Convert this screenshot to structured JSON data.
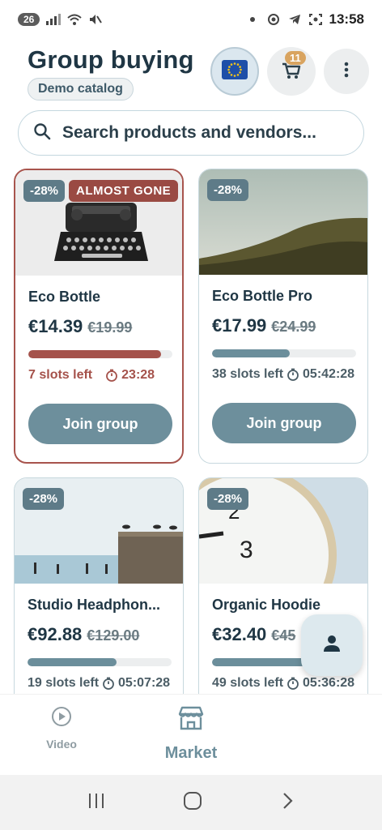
{
  "status_bar": {
    "notification_count": "26",
    "time": "13:58",
    "icons": [
      "sim-signal-icon",
      "wifi-icon",
      "mute-icon",
      "dot-icon",
      "chrome-icon",
      "telegram-icon",
      "screenshot-icon"
    ]
  },
  "header": {
    "title": "Group buying",
    "catalog_pill": "Demo catalog",
    "flag_icon": "eu-flag-icon",
    "cart_count": "11",
    "menu_icon": "more-vertical-icon"
  },
  "search": {
    "placeholder": "Search products and vendors..."
  },
  "products": [
    {
      "name": "Eco Bottle",
      "price": "€14.39",
      "old_price": "€19.99",
      "discount": "-28%",
      "badge": "ALMOST GONE",
      "slots": "7 slots left",
      "timer": "23:28",
      "progress": 0.92,
      "button": "Join group",
      "image": "typewriter-photo"
    },
    {
      "name": "Eco Bottle Pro",
      "price": "€17.99",
      "old_price": "€24.99",
      "discount": "-28%",
      "slots": "38 slots left",
      "timer": "05:42:28",
      "progress": 0.54,
      "button": "Join group",
      "image": "hill-landscape-photo"
    },
    {
      "name": "Studio Headphon...",
      "price": "€92.88",
      "old_price": "€129.00",
      "discount": "-28%",
      "slots": "19 slots left",
      "timer": "05:07:28",
      "progress": 0.62,
      "image": "sea-pier-birds-photo"
    },
    {
      "name": "Organic Hoodie",
      "price": "€32.40",
      "old_price": "€45",
      "discount": "-28%",
      "slots": "49 slots left",
      "timer": "05:36:28",
      "progress": 0.7,
      "image": "clock-closeup-photo"
    }
  ],
  "fab": {
    "icon": "person-icon"
  },
  "bottom_nav": {
    "video_label": "Video",
    "market_label": "Market"
  },
  "colors": {
    "primary": "#6d8f9c",
    "title": "#1f3644",
    "urgent": "#a5524b",
    "cart_badge": "#d9a460"
  }
}
